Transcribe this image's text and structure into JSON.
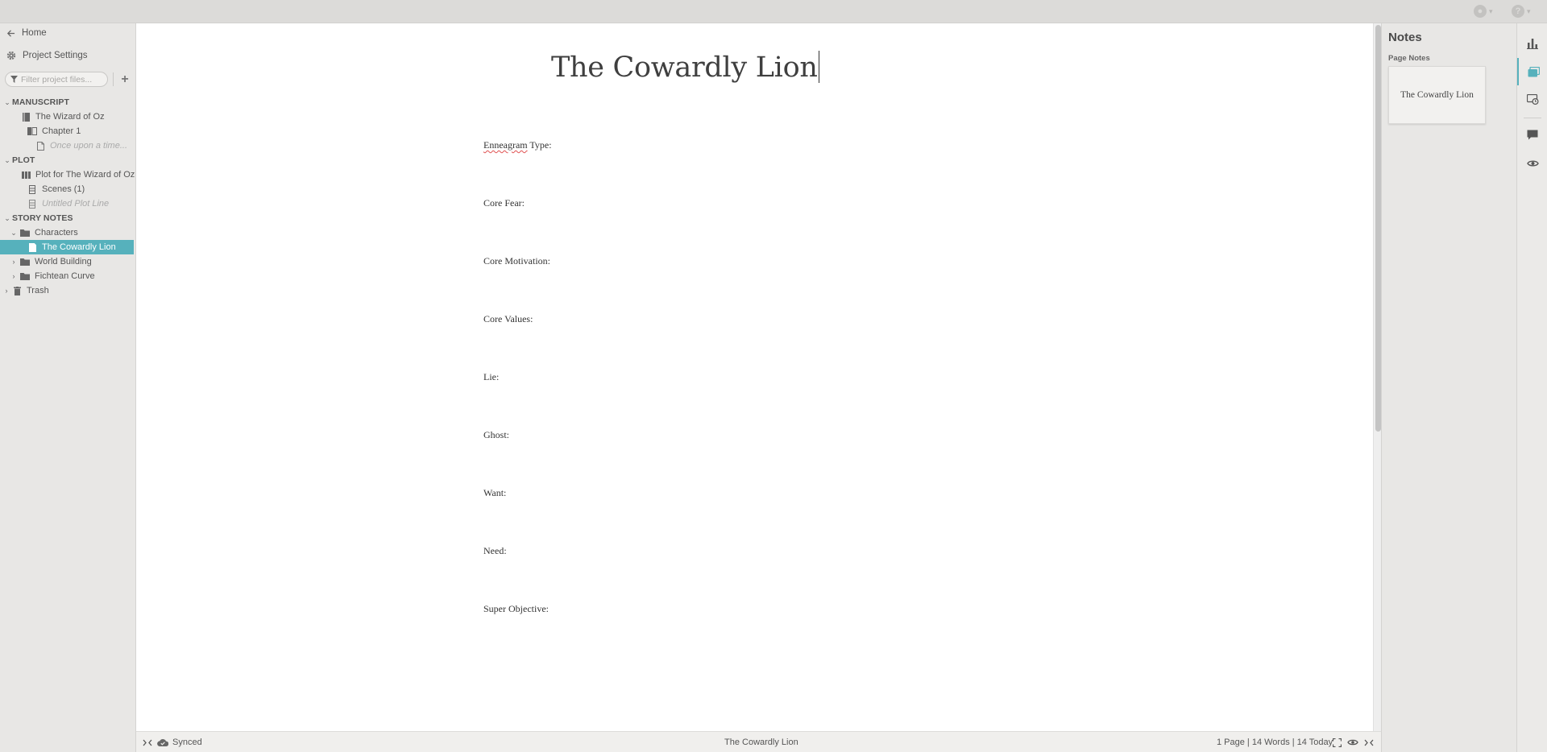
{
  "sidebar": {
    "home_label": "Home",
    "settings_label": "Project Settings",
    "filter_placeholder": "Filter project files...",
    "tree": [
      {
        "label": "MANUSCRIPT"
      },
      {
        "label": "The Wizard of Oz"
      },
      {
        "label": "Chapter 1"
      },
      {
        "label": "Once upon a time..."
      },
      {
        "label": "PLOT"
      },
      {
        "label": "Plot for The Wizard of Oz"
      },
      {
        "label": "Scenes  (1)"
      },
      {
        "label": "Untitled Plot Line"
      },
      {
        "label": "STORY NOTES"
      },
      {
        "label": "Characters"
      },
      {
        "label": "The Cowardly Lion"
      },
      {
        "label": "World Building"
      },
      {
        "label": "Fichtean Curve"
      },
      {
        "label": "Trash"
      }
    ]
  },
  "editor": {
    "title": "The Cowardly Lion",
    "fields": [
      {
        "label": "Enneagram",
        "rest": " Type:"
      },
      {
        "label": "Core Fear:"
      },
      {
        "label": "Core Motivation:"
      },
      {
        "label": "Core Values:"
      },
      {
        "label": "Lie:"
      },
      {
        "label": "Ghost:"
      },
      {
        "label": "Want:"
      },
      {
        "label": "Need:"
      },
      {
        "label": "Super Objective:"
      }
    ]
  },
  "statusbar": {
    "sync_status": "Synced",
    "document_name": "The Cowardly Lion",
    "stats": "1 Page | 14 Words | 14 Today"
  },
  "notes_panel": {
    "title": "Notes",
    "subtitle": "Page Notes",
    "card_label": "The Cowardly Lion"
  },
  "colors": {
    "accent": "#56b1bc",
    "sidebar_bg": "#e8e7e5",
    "editor_bg": "#ffffff"
  },
  "icons": {
    "rail": [
      "bar-chart-icon",
      "notes-icon",
      "snapshot-icon",
      "comment-icon",
      "eye-icon"
    ]
  }
}
